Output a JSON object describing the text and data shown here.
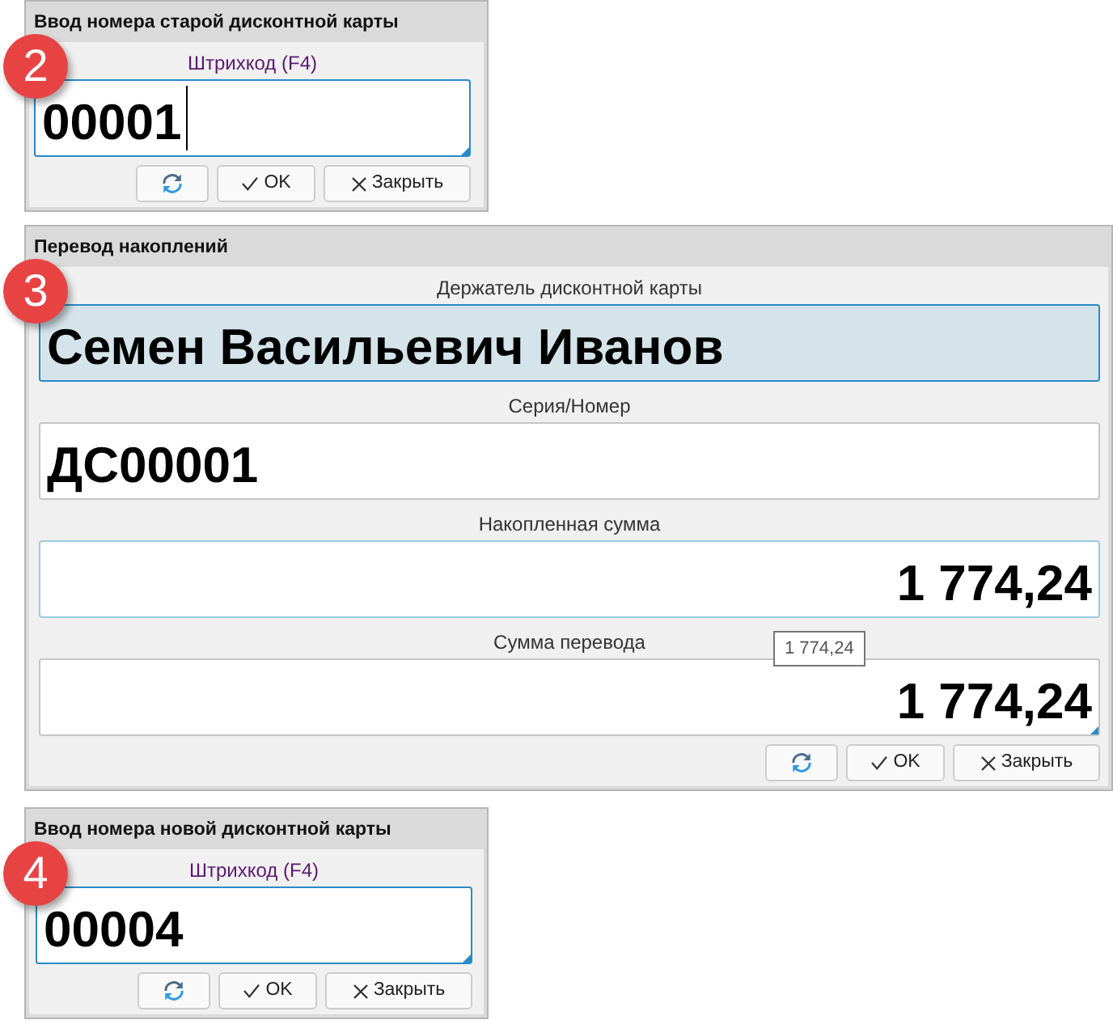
{
  "panels": [
    {
      "badge": "2",
      "title": "Ввод номера старой дисконтной карты",
      "fields": [
        {
          "kind": "barcode",
          "label": "Штрихкод (F4)",
          "value": "00001",
          "focused": true,
          "hovered": false,
          "highlighted": false,
          "caret": true,
          "grip": true
        }
      ],
      "buttons": [
        {
          "kind": "refresh"
        },
        {
          "kind": "ok",
          "label": "OK"
        },
        {
          "kind": "close",
          "label": "Закрыть"
        }
      ]
    },
    {
      "badge": "3",
      "title": "Перевод накоплений",
      "fields": [
        {
          "kind": "text",
          "label": "Держатель дисконтной карты",
          "value": "Семен Васильевич Иванов",
          "focused": true,
          "hovered": false,
          "highlighted": true,
          "caret": false,
          "grip": false
        },
        {
          "kind": "text",
          "label": "Серия/Номер",
          "value": "ДС00001",
          "focused": false,
          "hovered": false,
          "highlighted": false,
          "caret": false,
          "grip": false
        },
        {
          "kind": "amount",
          "label": "Накопленная сумма",
          "value": "1 774,24",
          "focused": false,
          "hovered": true,
          "highlighted": false,
          "caret": false,
          "grip": false
        },
        {
          "kind": "amount",
          "label": "Сумма перевода",
          "value": "1 774,24",
          "focused": false,
          "hovered": false,
          "highlighted": false,
          "caret": false,
          "grip": true,
          "tooltip": "1 774,24"
        }
      ],
      "buttons": [
        {
          "kind": "refresh"
        },
        {
          "kind": "ok",
          "label": "OK"
        },
        {
          "kind": "close",
          "label": "Закрыть"
        }
      ]
    },
    {
      "badge": "4",
      "title": "Ввод номера новой дисконтной карты",
      "fields": [
        {
          "kind": "barcode",
          "label": "Штрихкод (F4)",
          "value": "00004",
          "focused": true,
          "hovered": false,
          "highlighted": false,
          "caret": false,
          "grip": true
        }
      ],
      "buttons": [
        {
          "kind": "refresh"
        },
        {
          "kind": "ok",
          "label": "OK"
        },
        {
          "kind": "close",
          "label": "Закрыть"
        }
      ]
    }
  ]
}
